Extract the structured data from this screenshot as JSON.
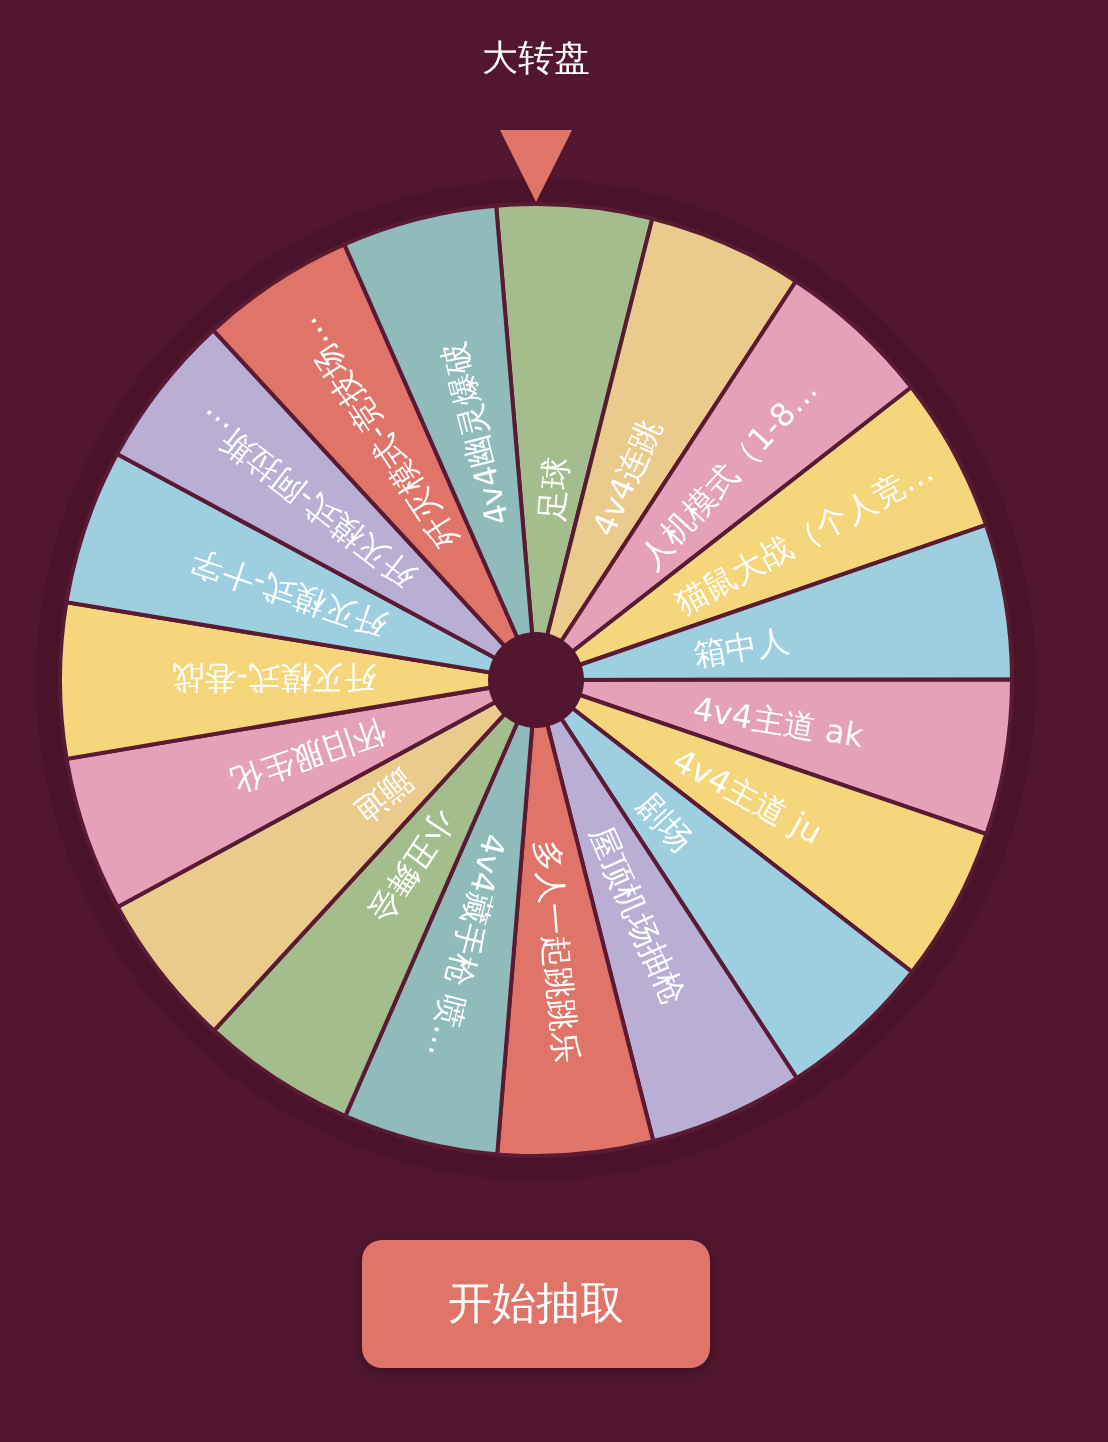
{
  "title": "大转盘",
  "segments": [
    {
      "label": "足球",
      "color": "#a3be8c"
    },
    {
      "label": "4v4连跳",
      "color": "#ebcb8b"
    },
    {
      "label": "人机模式（1-8…",
      "color": "#e6a1ba"
    },
    {
      "label": "猫鼠大战（个人竞…",
      "color": "#f5d67b"
    },
    {
      "label": "箱中人",
      "color": "#9ecfe0"
    },
    {
      "label": "4v4主道 ak",
      "color": "#e6a1ba"
    },
    {
      "label": "4v4主道 ju",
      "color": "#f5d67b"
    },
    {
      "label": "剧场",
      "color": "#9ecfe0"
    },
    {
      "label": "屋顶机场抽枪",
      "color": "#b9aed4"
    },
    {
      "label": "多人一起跳跳乐",
      "color": "#e07468"
    },
    {
      "label": "4v4藏手枪 喷…",
      "color": "#8fbcbb"
    },
    {
      "label": "小丑舞会",
      "color": "#a3be8c"
    },
    {
      "label": "蹦迪",
      "color": "#ebcb8b"
    },
    {
      "label": "怀旧服生化",
      "color": "#e6a1ba"
    },
    {
      "label": "歼灭模式-巷战",
      "color": "#f5d67b"
    },
    {
      "label": "歼灭模式-十字",
      "color": "#9ecfe0"
    },
    {
      "label": "歼灭模式-阿拉斯…",
      "color": "#b9aed4"
    },
    {
      "label": "歼灭模式-竞技场…",
      "color": "#e07468"
    },
    {
      "label": "4v4幽灵爆破",
      "color": "#8fbcbb"
    }
  ],
  "button": "开始抽取"
}
